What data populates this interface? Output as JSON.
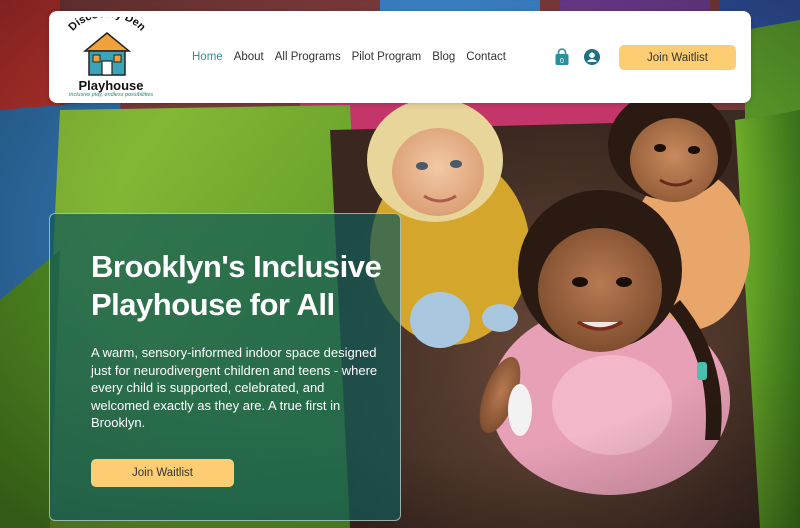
{
  "brand": {
    "arc_text": "Discovery Den",
    "name": "Playhouse",
    "tagline": "Inclusive play, endless possibilities"
  },
  "nav": {
    "items": [
      {
        "label": "Home",
        "active": true
      },
      {
        "label": "About",
        "active": false
      },
      {
        "label": "All Programs",
        "active": false
      },
      {
        "label": "Pilot Program",
        "active": false
      },
      {
        "label": "Blog",
        "active": false
      },
      {
        "label": "Contact",
        "active": false
      }
    ],
    "cart_count": "0",
    "cta_label": "Join Waitlist"
  },
  "hero": {
    "title": "Brooklyn's Inclusive Playhouse for All",
    "body": "A warm, sensory-informed indoor space designed just for neurodivergent children and teens - where every child is supported, celebrated, and welcomed exactly as they are. A true first in Brooklyn.",
    "cta_label": "Join Waitlist"
  },
  "colors": {
    "accent_teal": "#2b8fa0",
    "button_yellow": "#fccd73",
    "card_overlay": "#125a58",
    "logo_house_teal": "#3aa5b8",
    "logo_house_orange": "#f1a23c"
  },
  "icons": {
    "cart": "shopping-bag-icon",
    "account": "user-circle-icon"
  }
}
